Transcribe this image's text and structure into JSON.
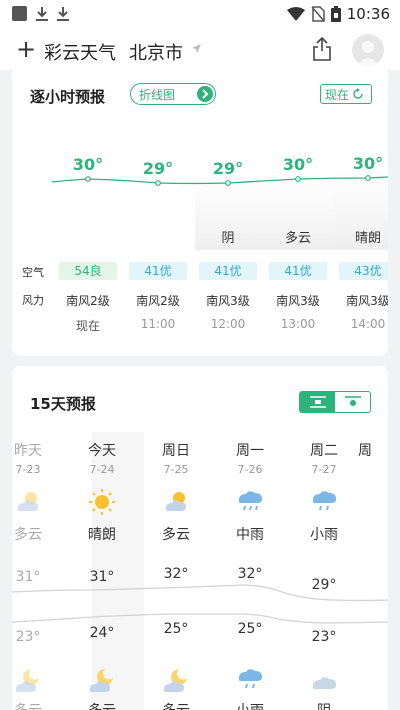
{
  "status_bar": {
    "time": "10:36"
  },
  "header": {
    "add_icon": "+",
    "app_title": "彩云天气",
    "city": "北京市"
  },
  "hourly": {
    "title": "逐小时预报",
    "chart_toggle_label": "折线图",
    "now_button_label": "现在",
    "air_label": "空气",
    "wind_label": "风力",
    "temps": [
      "30°",
      "29°",
      "29°",
      "30°",
      "30°"
    ],
    "conditions": [
      "",
      "",
      "阴",
      "多云",
      "晴朗"
    ],
    "aqi": [
      "54良",
      "41优",
      "41优",
      "41优",
      "43优"
    ],
    "winds": [
      "南风2级",
      "南风2级",
      "南风3级",
      "南风3级",
      "南风3级"
    ],
    "hours": [
      "现在",
      "11:00",
      "12:00",
      "13:00",
      "14:00"
    ],
    "accent_color": "#2db37c"
  },
  "daily": {
    "title": "15天预报",
    "days": [
      "昨天",
      "今天",
      "周日",
      "周一",
      "周二",
      "周"
    ],
    "dates": [
      "7-23",
      "7-24",
      "7-25",
      "7-26",
      "7-27"
    ],
    "day_conditions": [
      "多云",
      "晴朗",
      "多云",
      "中雨",
      "小雨"
    ],
    "highs": [
      "31°",
      "31°",
      "32°",
      "32°",
      "29°"
    ],
    "lows": [
      "23°",
      "24°",
      "25°",
      "25°",
      "23°"
    ],
    "night_conditions": [
      "多云",
      "多云",
      "多云",
      "小雨",
      "阴"
    ],
    "day_icons": [
      "partly-cloudy-icon",
      "sun-icon",
      "partly-cloudy-icon",
      "rain-cloud-icon",
      "rain-cloud-icon"
    ],
    "night_icons": [
      "moon-cloud-icon",
      "moon-cloud-icon",
      "moon-cloud-icon",
      "rain-cloud-icon",
      "cloud-icon"
    ]
  }
}
